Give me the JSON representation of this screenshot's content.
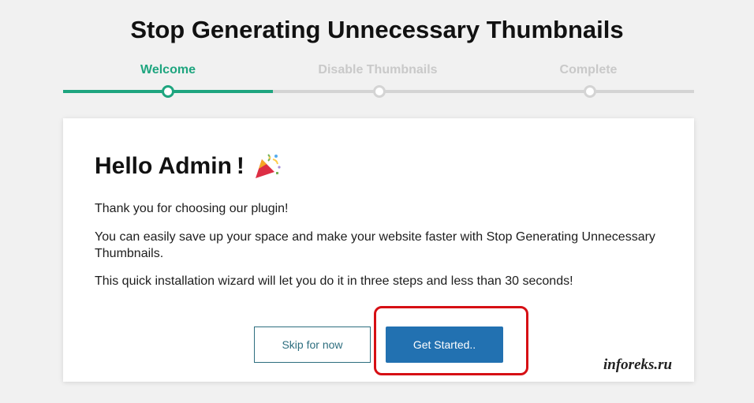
{
  "page": {
    "title": "Stop Generating Unnecessary Thumbnails"
  },
  "steps": [
    {
      "label": "Welcome",
      "active": true
    },
    {
      "label": "Disable Thumbnails",
      "active": false
    },
    {
      "label": "Complete",
      "active": false
    }
  ],
  "card": {
    "heading": "Hello Admin !",
    "heading_icon": "party-popper-icon",
    "paragraphs": [
      "Thank you for choosing our plugin!",
      "You can easily save up your space and make your website faster with Stop Generating Unnecessary Thumbnails.",
      "This quick installation wizard will let you do it in three steps and less than 30 seconds!"
    ],
    "skip_label": "Skip for now",
    "start_label": "Get Started.."
  },
  "annotation": {
    "highlight_color": "#d60f14"
  },
  "watermark": "inforeks.ru",
  "colors": {
    "accent": "#1ea57f",
    "primary_button": "#2271b1",
    "inactive": "#d4d4d4"
  }
}
